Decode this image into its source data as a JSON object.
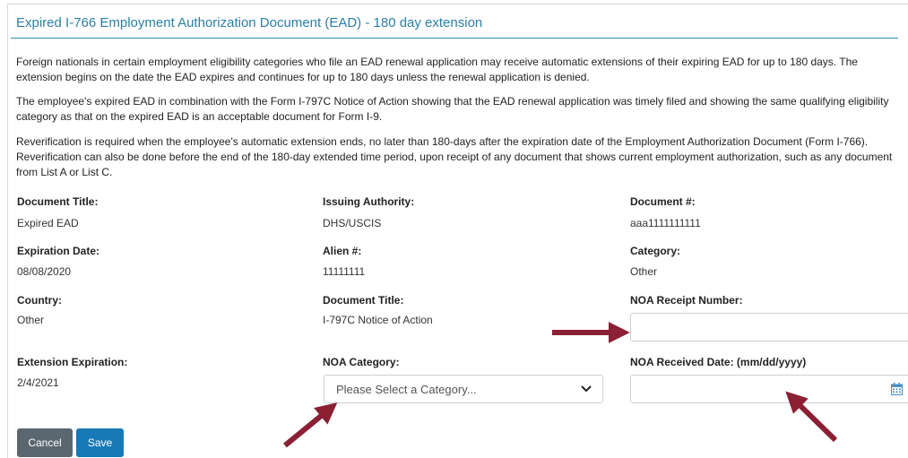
{
  "panel": {
    "title": "Expired I-766 Employment Authorization Document (EAD) - 180 day extension"
  },
  "paragraphs": [
    "Foreign nationals in certain employment eligibility categories who file an EAD renewal application may receive automatic extensions of their expiring EAD for up to 180 days. The extension begins on the date the EAD expires and continues for up to 180 days unless the renewal application is denied.",
    "The employee's expired EAD in combination with the Form I-797C Notice of Action showing that the EAD renewal application was timely filed and showing the same qualifying eligibility category as that on the expired EAD is an acceptable document for Form I-9.",
    "Reverification is required when the employee's automatic extension ends, no later than 180-days after the expiration date of the Employment Authorization Document (Form I-766). Reverification can also be done before the end of the 180-day extended time period, upon receipt of any document that shows current employment authorization, such as any document from List A or List C."
  ],
  "fields": {
    "document_title": {
      "label": "Document Title:",
      "value": "Expired EAD"
    },
    "issuing_authority": {
      "label": "Issuing Authority:",
      "value": "DHS/USCIS"
    },
    "document_number": {
      "label": "Document #:",
      "value": "aaa1111111111"
    },
    "expiration_date": {
      "label": "Expiration Date:",
      "value": "08/08/2020"
    },
    "alien_number": {
      "label": "Alien #:",
      "value": "11111111"
    },
    "category": {
      "label": "Category:",
      "value": "Other"
    },
    "country": {
      "label": "Country:",
      "value": "Other"
    },
    "document_title_2": {
      "label": "Document Title:",
      "value": "I-797C Notice of Action"
    },
    "noa_receipt_number": {
      "label": "NOA Receipt Number:",
      "value": ""
    },
    "extension_expiration": {
      "label": "Extension Expiration:",
      "value": "2/4/2021"
    },
    "noa_category": {
      "label": "NOA Category:",
      "selected": "Please Select a Category..."
    },
    "noa_received_date": {
      "label": "NOA Received Date: (mm/dd/yyyy)",
      "value": ""
    }
  },
  "buttons": {
    "cancel": "Cancel",
    "save": "Save"
  },
  "colors": {
    "title": "#2b7fa6",
    "rule": "#2b8fb6",
    "cancel_bg": "#5b6770",
    "save_bg": "#1779b7",
    "annotation_arrow": "#8b1f33"
  },
  "icons": [
    "chevron-down-icon",
    "calendar-icon",
    "annotation-arrow"
  ]
}
